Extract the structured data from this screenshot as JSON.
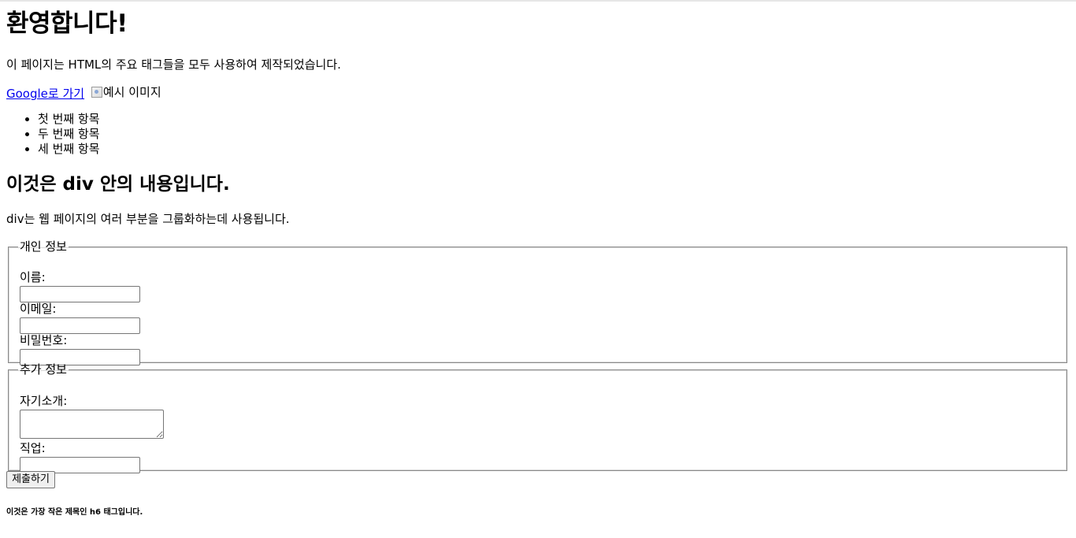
{
  "header": {
    "title": "환영합니다!"
  },
  "intro": {
    "text": "이 페이지는 HTML의 주요 태그들을 모두 사용하여 제작되었습니다."
  },
  "link": {
    "text": "Google로 가기"
  },
  "image": {
    "alt": "예시 이미지",
    "icon": "broken-image-icon"
  },
  "list": {
    "items": [
      "첫 번째 항목",
      "두 번째 항목",
      "세 번째 항목"
    ]
  },
  "div_section": {
    "heading": "이것은 div 안의 내용입니다.",
    "text": "div는 웹 페이지의 여러 부분을 그룹화하는데 사용됩니다."
  },
  "personal_info": {
    "legend": "개인 정보",
    "name_label": "이름:",
    "name_value": "",
    "email_label": "이메일:",
    "email_value": "",
    "password_label": "비밀번호:",
    "password_value": ""
  },
  "extra_info": {
    "legend": "추가 정보",
    "bio_label": "자기소개:",
    "bio_value": "",
    "job_label": "직업:",
    "job_value": ""
  },
  "form": {
    "submit_label": "제출하기"
  },
  "footer": {
    "h6_text": "이것은 가장 작은 제목인 h6 태그입니다."
  },
  "colors": {
    "link": "#0000ee",
    "text": "#000000",
    "fieldset_border": "#8a8a8a",
    "button_bg": "#efefef"
  }
}
